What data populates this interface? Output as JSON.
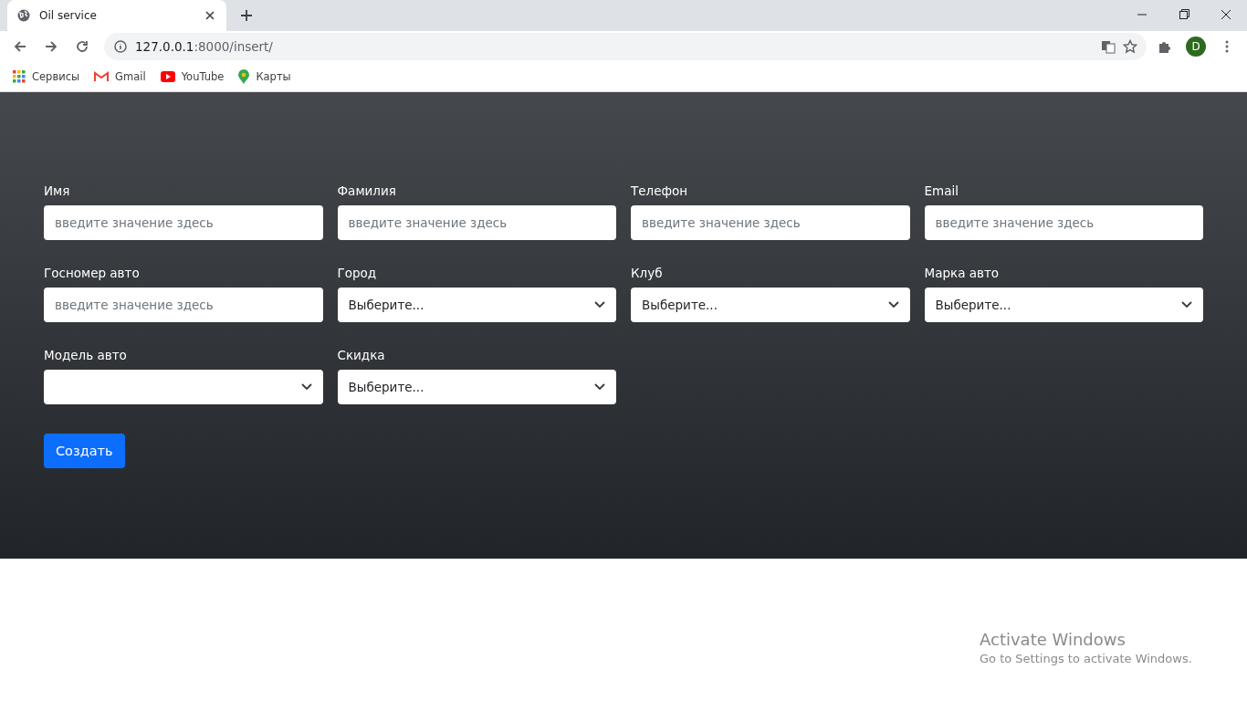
{
  "browser": {
    "tab": {
      "title": "Oil service"
    },
    "address": {
      "host": "127.0.0.1",
      "path": ":8000/insert/"
    },
    "profile_initial": "D",
    "bookmarks": [
      {
        "label": "Сервисы",
        "kind": "apps"
      },
      {
        "label": "Gmail",
        "kind": "gmail"
      },
      {
        "label": "YouTube",
        "kind": "youtube"
      },
      {
        "label": "Карты",
        "kind": "maps"
      }
    ]
  },
  "form": {
    "fields": [
      {
        "label": "Имя",
        "kind": "text",
        "placeholder": "введите значение здесь"
      },
      {
        "label": "Фамилия",
        "kind": "text",
        "placeholder": "введите значение здесь"
      },
      {
        "label": "Телефон",
        "kind": "text",
        "placeholder": "введите значение здесь"
      },
      {
        "label": "Email",
        "kind": "text",
        "placeholder": "введите значение здесь"
      },
      {
        "label": "Госномер авто",
        "kind": "text",
        "placeholder": "введите значение здесь"
      },
      {
        "label": "Город",
        "kind": "select",
        "value": "Выберите..."
      },
      {
        "label": "Клуб",
        "kind": "select",
        "value": "Выберите..."
      },
      {
        "label": "Марка авто",
        "kind": "select",
        "value": "Выберите..."
      },
      {
        "label": "Модель авто",
        "kind": "select"
      },
      {
        "label": "Скидка",
        "kind": "select",
        "value": "Выберите..."
      }
    ],
    "submit": "Создать"
  },
  "os_notice": {
    "title": "Activate Windows",
    "text": "Go to Settings to activate Windows."
  }
}
